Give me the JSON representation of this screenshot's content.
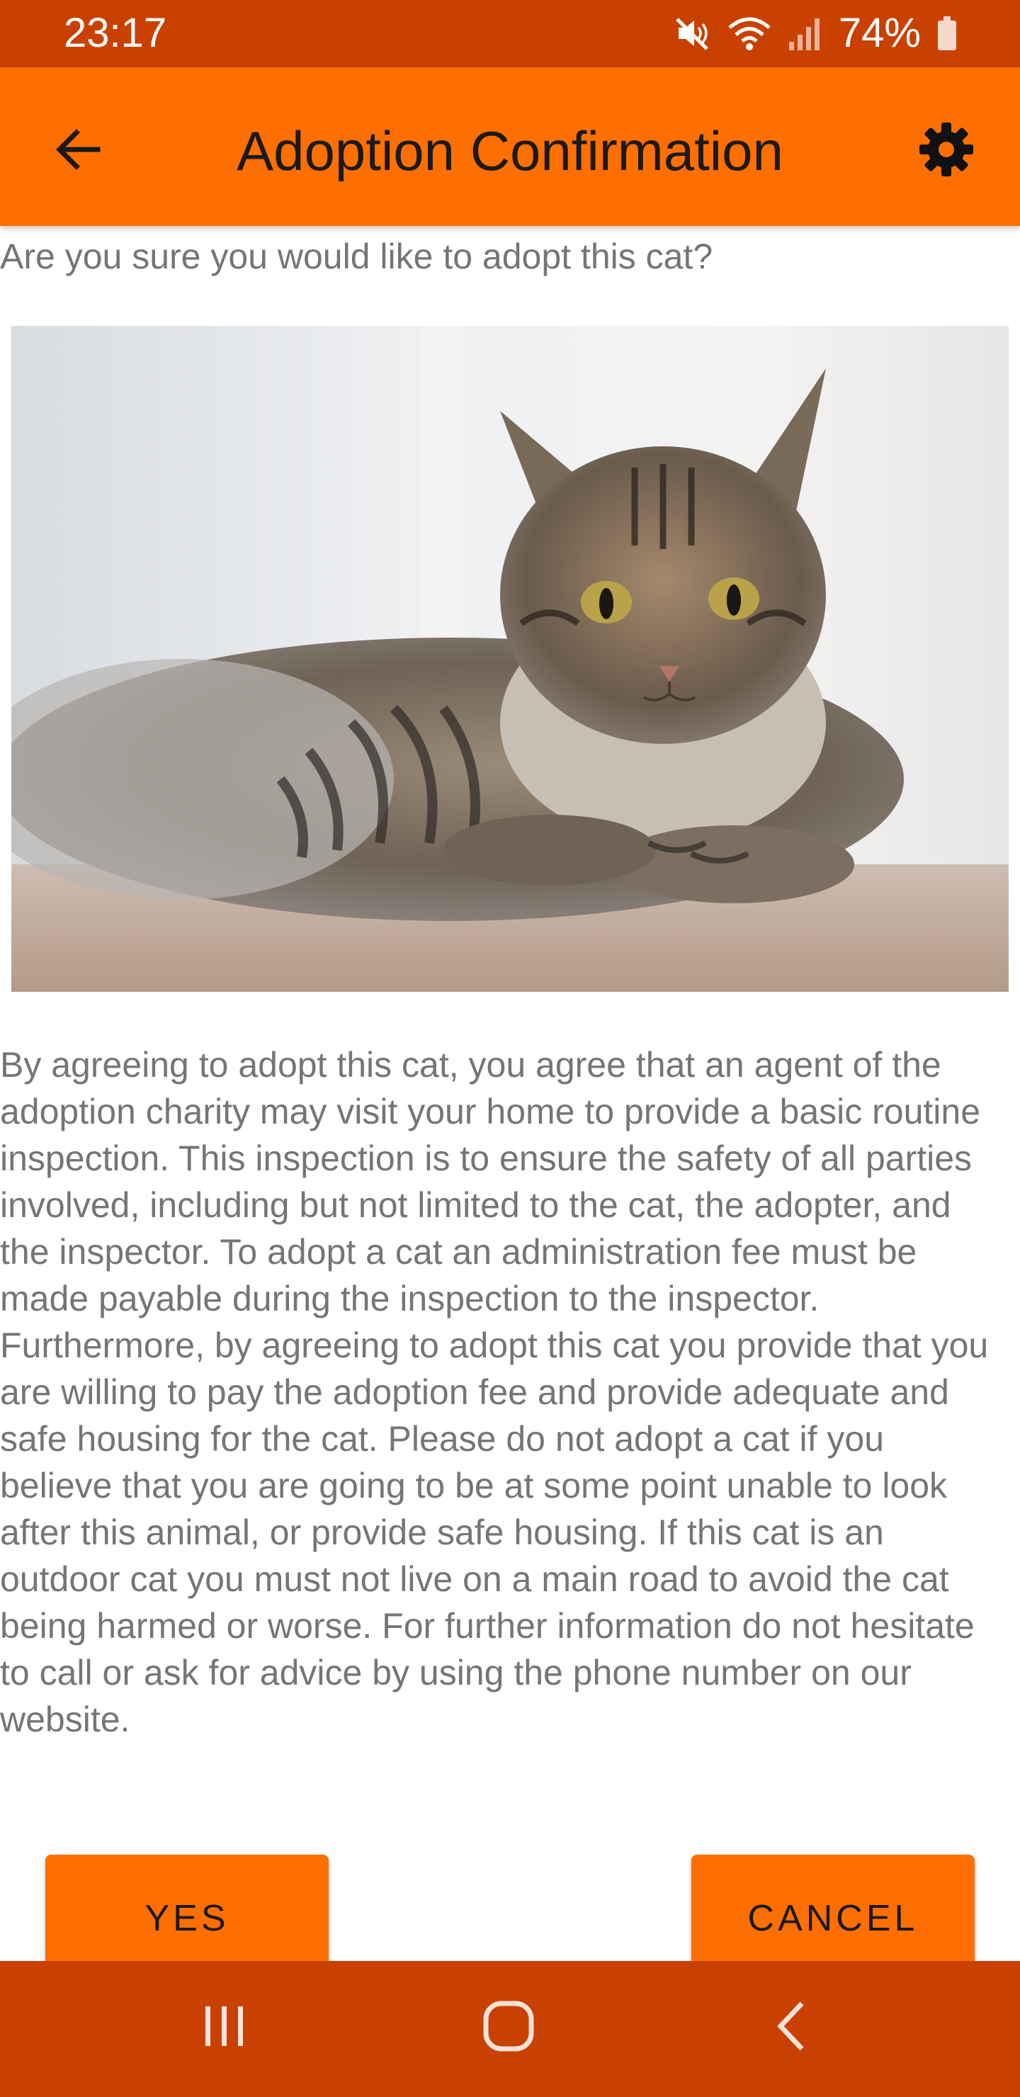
{
  "status_bar": {
    "time": "23:17",
    "battery": "74%",
    "icons": [
      "mute-icon",
      "wifi-icon",
      "signal-icon",
      "battery-icon"
    ]
  },
  "app_bar": {
    "title": "Adoption Confirmation",
    "back_icon": "arrow-back-icon",
    "settings_icon": "gear-icon"
  },
  "content": {
    "question": "Are you sure you would like to adopt this cat?",
    "terms": "By agreeing to adopt this cat, you agree that an agent of the adoption charity may visit your home to provide a basic routine inspection. This inspection is to ensure the safety of all parties involved, including but not limited to the cat, the adopter, and the inspector. To adopt a cat an administration fee must be made payable during the inspection to the inspector. Furthermore, by agreeing to adopt this cat you provide that you are willing to pay the adoption fee and provide adequate and safe housing for the cat. Please do not adopt a cat if you believe that you are going to be at some point unable to look after this animal, or provide safe housing. If this cat is an outdoor cat you must not live on a main road to avoid the cat being harmed or worse. For further information do not hesitate to call or ask for advice by using the phone number on our website."
  },
  "buttons": {
    "yes": "YES",
    "cancel": "CANCEL"
  },
  "nav_bar": {
    "icons": [
      "recents-icon",
      "home-icon",
      "back-icon"
    ]
  },
  "colors": {
    "status_bar": "#C94100",
    "app_bar": "#FF6F00",
    "button": "#FF6F00",
    "body_text": "#757575"
  }
}
